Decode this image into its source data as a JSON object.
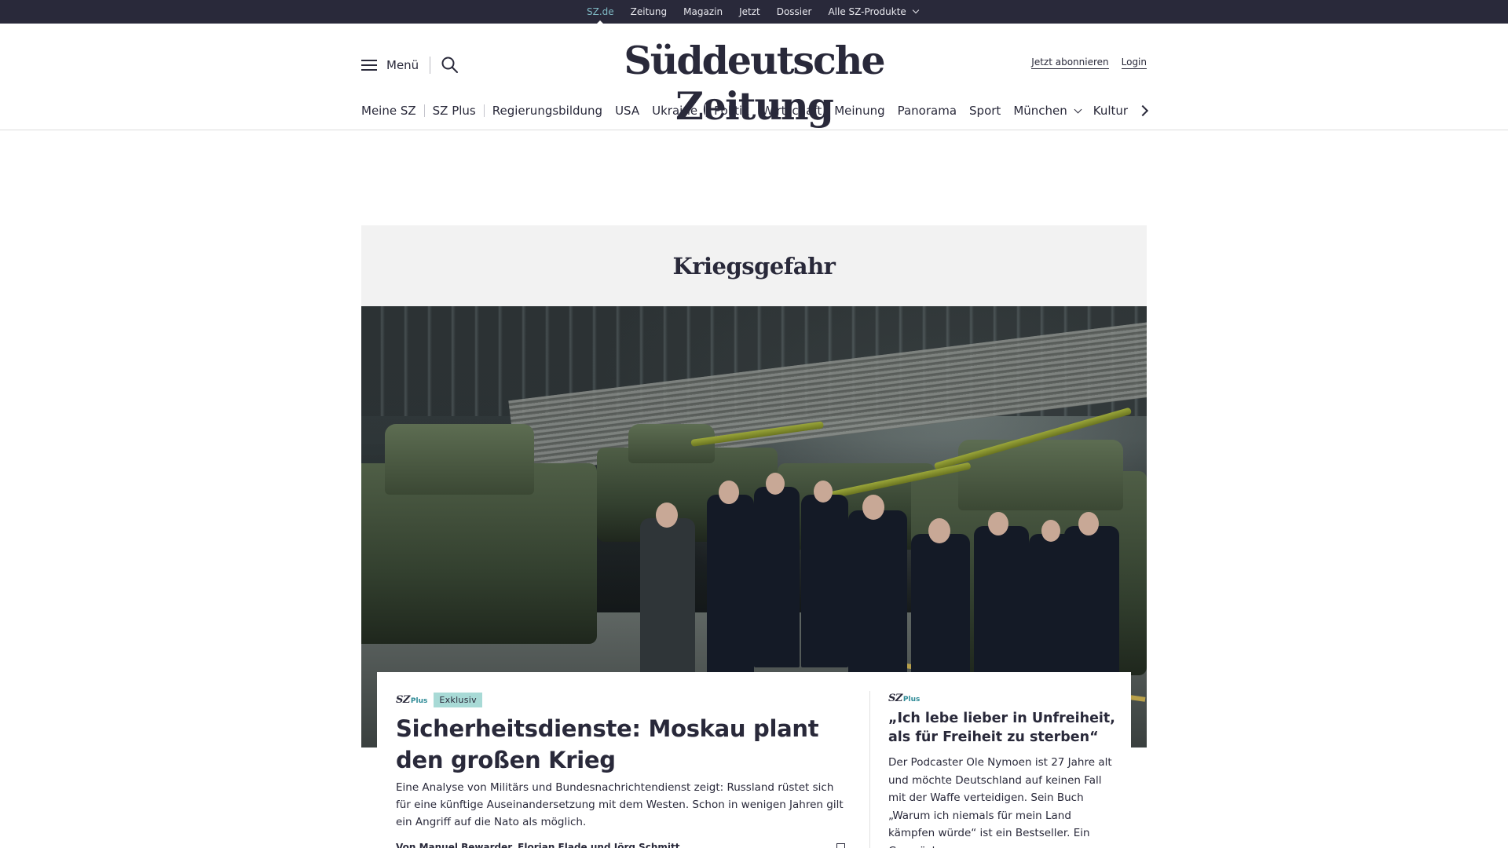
{
  "topbar": {
    "links": [
      {
        "label": "SZ.de",
        "active": true
      },
      {
        "label": "Zeitung"
      },
      {
        "label": "Magazin"
      },
      {
        "label": "Jetzt"
      },
      {
        "label": "Dossier"
      },
      {
        "label": "Alle SZ-Produkte",
        "dropdown": true
      }
    ]
  },
  "header": {
    "menu_label": "Menü",
    "logo": "Süddeutsche Zeitung",
    "subscribe_label": "Jetzt abonnieren",
    "login_label": "Login",
    "nav": [
      "Meine SZ",
      "SZ Plus",
      "Regierungsbildung",
      "USA",
      "Ukraine",
      "Politik",
      "Wirtschaft",
      "Meinung",
      "Panorama",
      "Sport",
      "München",
      "Kultur"
    ]
  },
  "dossier": {
    "title": "Kriegsgefahr"
  },
  "hero": {
    "image_alt_icon": "photo"
  },
  "lead_article": {
    "brand_sz": "SZ",
    "brand_plus": "Plus",
    "tag": "Exklusiv",
    "headline": "Sicherheitsdienste: Moskau plant den großen Krieg",
    "teaser": "Eine Analyse von Militärs und Bundesnachrichtendienst zeigt: Russland rüstet sich für eine künftige Auseinandersetzung mit dem Westen. Schon in wenigen Jahren gilt ein Angriff auf die Nato als möglich.",
    "byline": "Von Manuel Bewarder, Florian Flade und Jörg Schmitt"
  },
  "side_article": {
    "brand_sz": "SZ",
    "brand_plus": "Plus",
    "headline": "„Ich lebe lieber in Unfreiheit, als für Freiheit zu sterben“",
    "teaser": "Der Podcaster Ole Nymoen ist 27 Jahre alt und möchte Deutschland auf keinen Fall mit der Waffe verteidigen. Sein Buch „Warum ich niemals für mein Land kämpfen würde“ ist ein Bestseller.  Ein Gespräch."
  },
  "colors": {
    "topbar_bg": "#29293a",
    "text": "#29293a",
    "active_link": "#7fb9c4",
    "exklusiv_bg": "#a8dad6",
    "plus_accent": "#2d8a96",
    "dossier_bg": "#f2f2f2"
  }
}
